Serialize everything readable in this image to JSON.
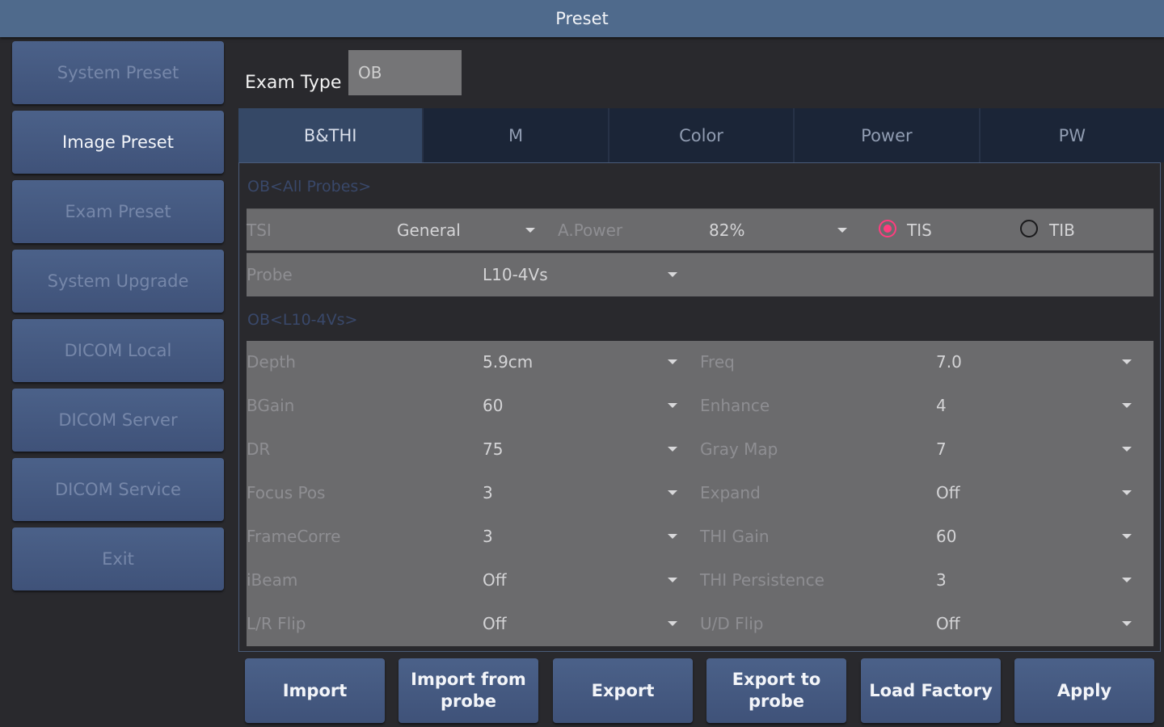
{
  "window": {
    "title": "Preset"
  },
  "sidebar": {
    "items": [
      {
        "label": "System Preset",
        "active": false
      },
      {
        "label": "Image Preset",
        "active": true
      },
      {
        "label": "Exam Preset",
        "active": false
      },
      {
        "label": "System Upgrade",
        "active": false
      },
      {
        "label": "DICOM Local",
        "active": false
      },
      {
        "label": "DICOM Server",
        "active": false
      },
      {
        "label": "DICOM Service",
        "active": false
      },
      {
        "label": "Exit",
        "active": false
      }
    ]
  },
  "exam_type": {
    "label": "Exam Type",
    "value": "OB"
  },
  "tabs": [
    {
      "label": "B&THI",
      "active": true
    },
    {
      "label": "M",
      "active": false
    },
    {
      "label": "Color",
      "active": false
    },
    {
      "label": "Power",
      "active": false
    },
    {
      "label": "PW",
      "active": false
    }
  ],
  "all_probes": {
    "title": "OB<All Probes>",
    "tsi_label": "TSI",
    "tsi_value": "General",
    "apower_label": "A.Power",
    "apower_value": "82%",
    "tis_label": "TIS",
    "tib_label": "TIB",
    "selected_index": "TIS",
    "probe_label": "Probe",
    "probe_value": "L10-4Vs"
  },
  "probe_section": {
    "title": "OB<L10-4Vs>",
    "rows": [
      {
        "left_label": "Depth",
        "left_value": "5.9cm",
        "right_label": "Freq",
        "right_value": "7.0"
      },
      {
        "left_label": "BGain",
        "left_value": "60",
        "right_label": "Enhance",
        "right_value": "4"
      },
      {
        "left_label": "DR",
        "left_value": "75",
        "right_label": "Gray Map",
        "right_value": "7"
      },
      {
        "left_label": "Focus Pos",
        "left_value": "3",
        "right_label": "Expand",
        "right_value": "Off"
      },
      {
        "left_label": "FrameCorre",
        "left_value": "3",
        "right_label": "THI Gain",
        "right_value": "60"
      },
      {
        "left_label": "iBeam",
        "left_value": "Off",
        "right_label": "THI Persistence",
        "right_value": "3"
      },
      {
        "left_label": "L/R Flip",
        "left_value": "Off",
        "right_label": "U/D Flip",
        "right_value": "Off"
      }
    ]
  },
  "actions": {
    "import": "Import",
    "import_probe_line1": "Import from",
    "import_probe_line2": "probe",
    "export": "Export",
    "export_probe": "Export to probe",
    "load_factory": "Load Factory",
    "apply": "Apply"
  },
  "colors": {
    "title_bar": "#4f6a8c",
    "button": "#44587f",
    "radio_selected": "#ff3d7f"
  }
}
